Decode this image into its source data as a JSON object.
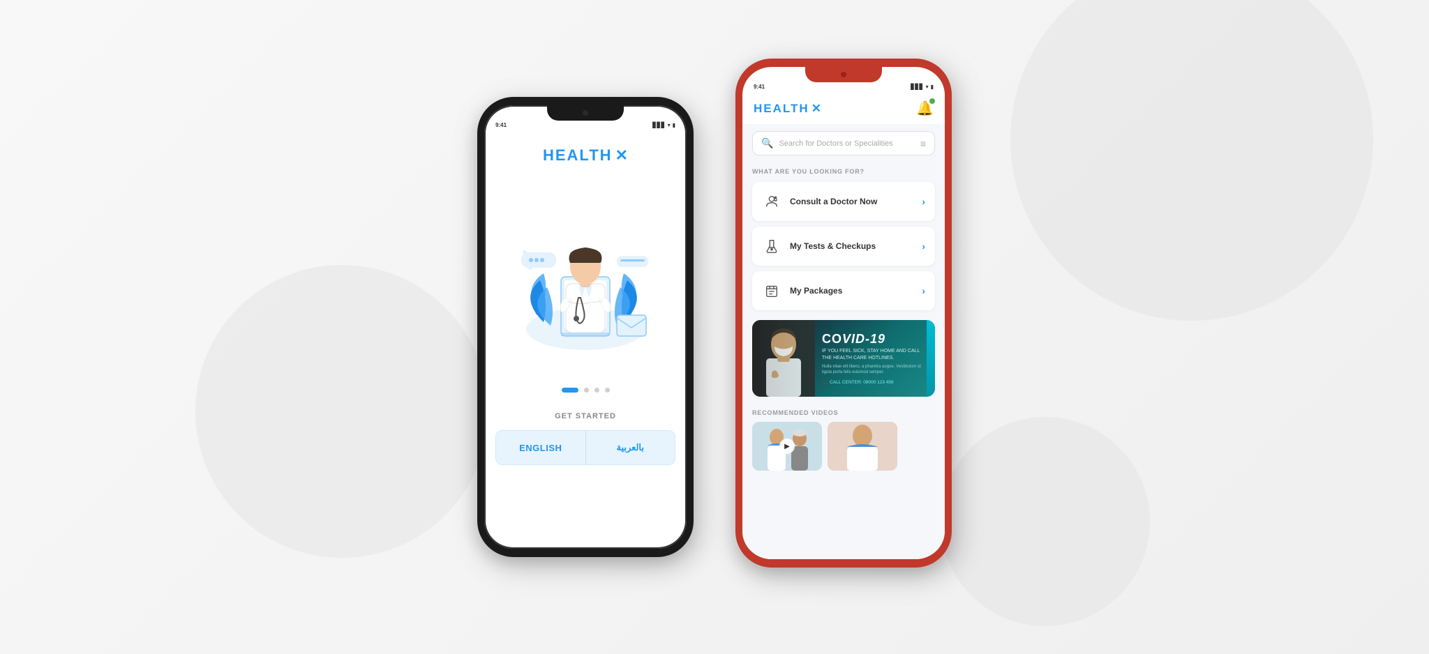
{
  "scene": {
    "background": "#f5f5f7"
  },
  "left_phone": {
    "logo": "HEALTH",
    "logo_x": "✕",
    "dots": [
      {
        "active": true
      },
      {
        "active": false
      },
      {
        "active": false
      },
      {
        "active": false
      }
    ],
    "get_started_label": "GET STARTED",
    "lang_buttons": [
      {
        "label": "ENGLISH",
        "key": "english"
      },
      {
        "label": "بالعربية",
        "key": "arabic"
      }
    ]
  },
  "right_phone": {
    "logo": "HEALTH",
    "logo_x": "✕",
    "search_placeholder": "Search for Doctors or Specialities",
    "section_label": "WHAT ARE YOU LOOKING FOR?",
    "menu_items": [
      {
        "icon": "👨‍⚕️",
        "label": "Consult a Doctor Now"
      },
      {
        "icon": "🧪",
        "label": "My Tests & Checkups"
      },
      {
        "icon": "📋",
        "label": "My Packages"
      }
    ],
    "covid_banner": {
      "title": "COVID-19",
      "subtitle": "IF YOU FEEL SICK, STAY HOME AND\nCALL THE HEALTH CARE HOTLINES.",
      "body_text": "Nulla vitae elit libero, a pharetra augue. Vestibulum id ligula porta felis euismod semper.",
      "call_label": "CALL CENTER: 08000 123 456"
    },
    "recommended_label": "RECOMMENDED VIDEOS"
  }
}
